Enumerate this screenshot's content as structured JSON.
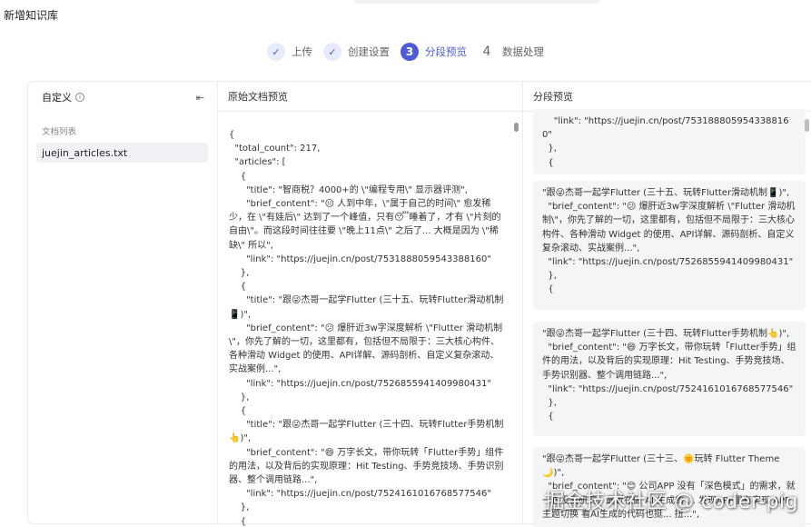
{
  "header": {
    "title": "新增知识库"
  },
  "steps": [
    {
      "num": "✓",
      "label": "上传",
      "state": "done"
    },
    {
      "num": "✓",
      "label": "创建设置",
      "state": "done"
    },
    {
      "num": "3",
      "label": "分段预览",
      "state": "active"
    },
    {
      "num": "4",
      "label": "数据处理",
      "state": "todo"
    }
  ],
  "left": {
    "title": "自定义",
    "info_icon": "info-icon",
    "collapse_icon": "collapse-icon",
    "doc_list_label": "文档列表",
    "doc_item": "juejin_articles.txt"
  },
  "middle": {
    "title": "原始文档预览",
    "raw_text": "{\n  \"total_count\": 217,\n  \"articles\": [\n    {\n      \"title\": \"智商税？4000+的 \\\"编程专用\\\" 显示器评测\",\n      \"brief_content\": \"😐 人到中年，\\\"属于自己的时间\\\" 愈发稀少，在 \\\"有娃后\\\" 达到了一个峰值，只有😴睡着了，才有 \\\"片刻的自由\\\"。而这段时间往往要 \\\"晚上11点\\\" 之后了... 大概是因为 \\\"稀缺\\\" 所以\",\n      \"link\": \"https://juejin.cn/post/7531888059543388160\"\n    },\n    {\n      \"title\": \"跟😜杰哥一起学Flutter (三十五、玩转Flutter滑动机制📱)\",\n      \"brief_content\": \"😕 爆肝近3w字深度解析 \\\"Flutter 滑动机制\\\"，你先了解的一切，这里都有，包括但不局限于：三大核心构件、各种滑动 Widget 的使用、API详解、源码剖析、自定义复杂滚动、实战案例...\",\n      \"link\": \"https://juejin.cn/post/7526855941409980431\"\n    },\n    {\n      \"title\": \"跟😜杰哥一起学Flutter (三十四、玩转Flutter手势机制👆)\",\n      \"brief_content\": \"😄 万字长文，带你玩转「Flutter手势」组件的用法，以及背后的实现原理：Hit Testing、手势竞技场、手势识别器、整个调用链路...\",\n      \"link\": \"https://juejin.cn/post/7524161016768577546\"\n    },\n    {"
  },
  "right": {
    "title": "分段预览",
    "segments": [
      "    \"link\": \"https://juejin.cn/post/7531888059543388160\"\n  },\n  {",
      "\"跟😜杰哥一起学Flutter (三十五、玩转Flutter滑动机制📱)\",\n  \"brief_content\": \"😕 爆肝近3w字深度解析 \\\"Flutter 滑动机制\\\"，你先了解的一切，这里都有，包括但不局限于：三大核心构件、各种滑动 Widget 的使用、API详解、源码剖析、自定义复杂滚动、实战案例...\",\n  \"link\": \"https://juejin.cn/post/7526855941409980431\"\n  },\n  {",
      "\"跟😜杰哥一起学Flutter (三十四、玩转Flutter手势机制👆)\",\n  \"brief_content\": \"😄 万字长文，带你玩转「Flutter手势」组件的用法，以及背后的实现原理：Hit Testing、手势竞技场、手势识别器、整个调用链路...\",\n  \"link\": \"https://juejin.cn/post/7524161016768577546\"\n  },\n  {",
      "\"跟😜杰哥一起学Flutter (三十三、🌞玩转 Flutter Theme🌙)\",\n  \"brief_content\": \"😊 公司APP 没有「深色模式」的需求，就一直没去研究，最近在做 AI 生成的 ... 发现APP里有实现 APP 主题切换 看AI生成的代码也挺... 扭...\","
    ]
  },
  "watermark": "掘金技术社区 @ coder-pig"
}
